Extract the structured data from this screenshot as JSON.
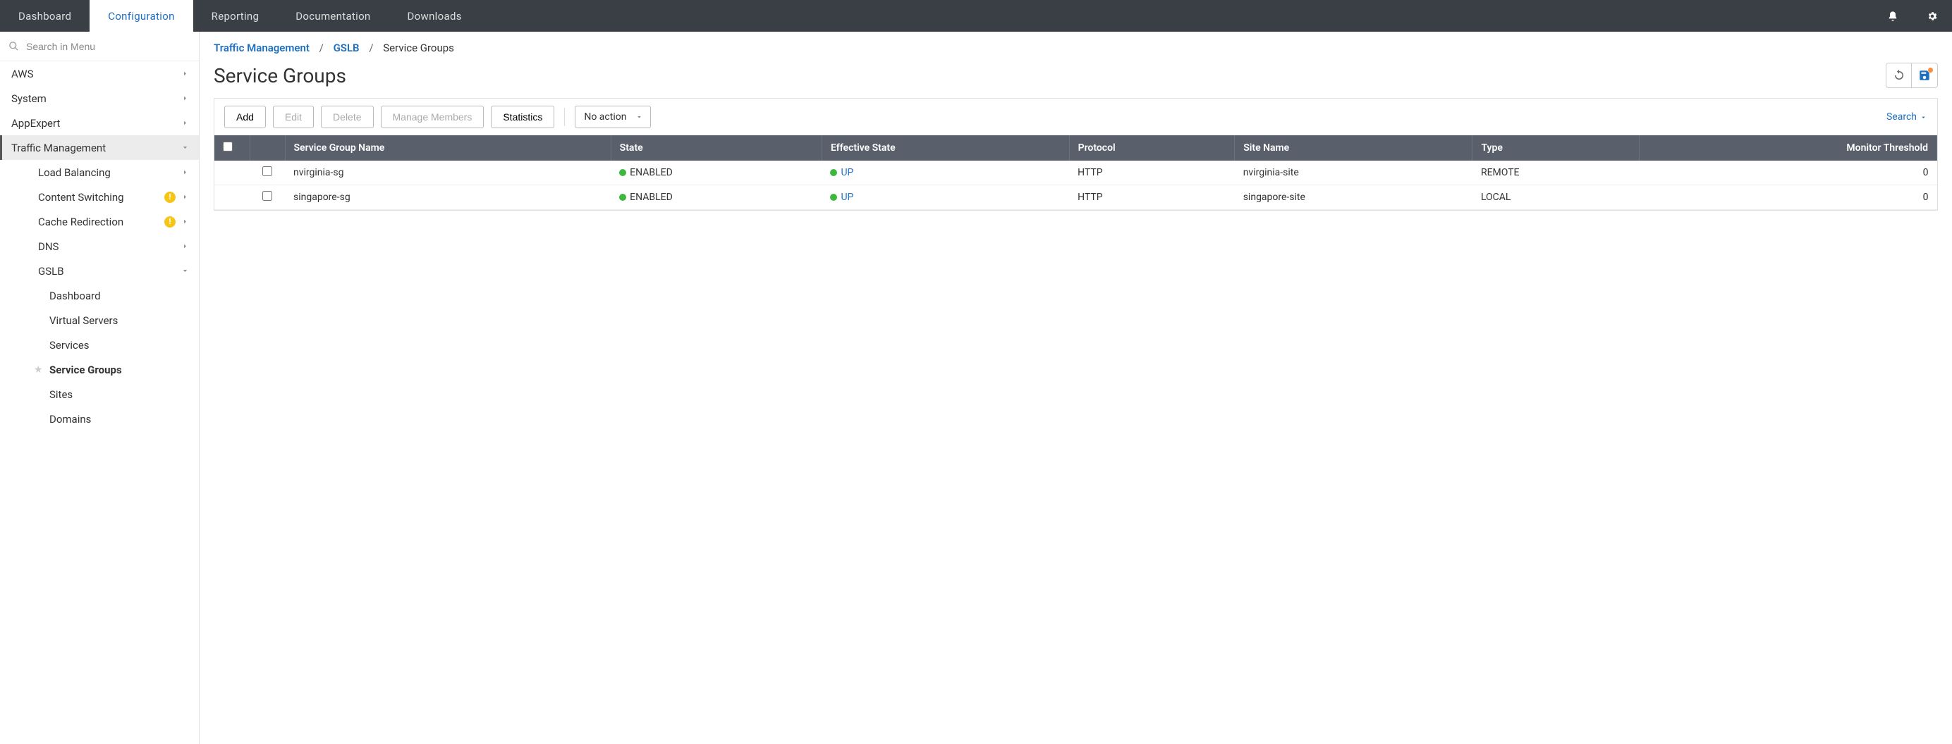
{
  "topnav": {
    "tabs": [
      {
        "label": "Dashboard"
      },
      {
        "label": "Configuration"
      },
      {
        "label": "Reporting"
      },
      {
        "label": "Documentation"
      },
      {
        "label": "Downloads"
      }
    ],
    "active_index": 1
  },
  "sidebar": {
    "search_placeholder": "Search in Menu",
    "items": [
      {
        "label": "AWS",
        "expandable": true
      },
      {
        "label": "System",
        "expandable": true
      },
      {
        "label": "AppExpert",
        "expandable": true
      },
      {
        "label": "Traffic Management",
        "expandable": true,
        "selected": true,
        "expanded": true
      },
      {
        "label": "Load Balancing",
        "depth": 1,
        "expandable": true
      },
      {
        "label": "Content Switching",
        "depth": 1,
        "expandable": true,
        "warn": true
      },
      {
        "label": "Cache Redirection",
        "depth": 1,
        "expandable": true,
        "warn": true
      },
      {
        "label": "DNS",
        "depth": 1,
        "expandable": true
      },
      {
        "label": "GSLB",
        "depth": 1,
        "expandable": true,
        "expanded": true
      },
      {
        "label": "Dashboard",
        "depth": 2
      },
      {
        "label": "Virtual Servers",
        "depth": 2
      },
      {
        "label": "Services",
        "depth": 2
      },
      {
        "label": "Service Groups",
        "depth": 2,
        "active_leaf": true
      },
      {
        "label": "Sites",
        "depth": 2
      },
      {
        "label": "Domains",
        "depth": 2
      }
    ]
  },
  "breadcrumb": {
    "items": [
      {
        "label": "Traffic Management",
        "link": true
      },
      {
        "label": "GSLB",
        "link": true
      },
      {
        "label": "Service Groups",
        "link": false
      }
    ]
  },
  "page": {
    "title": "Service Groups"
  },
  "toolbar": {
    "add_label": "Add",
    "edit_label": "Edit",
    "delete_label": "Delete",
    "manage_members_label": "Manage Members",
    "statistics_label": "Statistics",
    "action_select": "No action",
    "search_label": "Search"
  },
  "table": {
    "columns": [
      "Service Group Name",
      "State",
      "Effective State",
      "Protocol",
      "Site Name",
      "Type",
      "Monitor Threshold"
    ],
    "rows": [
      {
        "name": "nvirginia-sg",
        "state": "ENABLED",
        "effective_state": "UP",
        "protocol": "HTTP",
        "site": "nvirginia-site",
        "type": "REMOTE",
        "threshold": "0"
      },
      {
        "name": "singapore-sg",
        "state": "ENABLED",
        "effective_state": "UP",
        "protocol": "HTTP",
        "site": "singapore-site",
        "type": "LOCAL",
        "threshold": "0"
      }
    ]
  }
}
